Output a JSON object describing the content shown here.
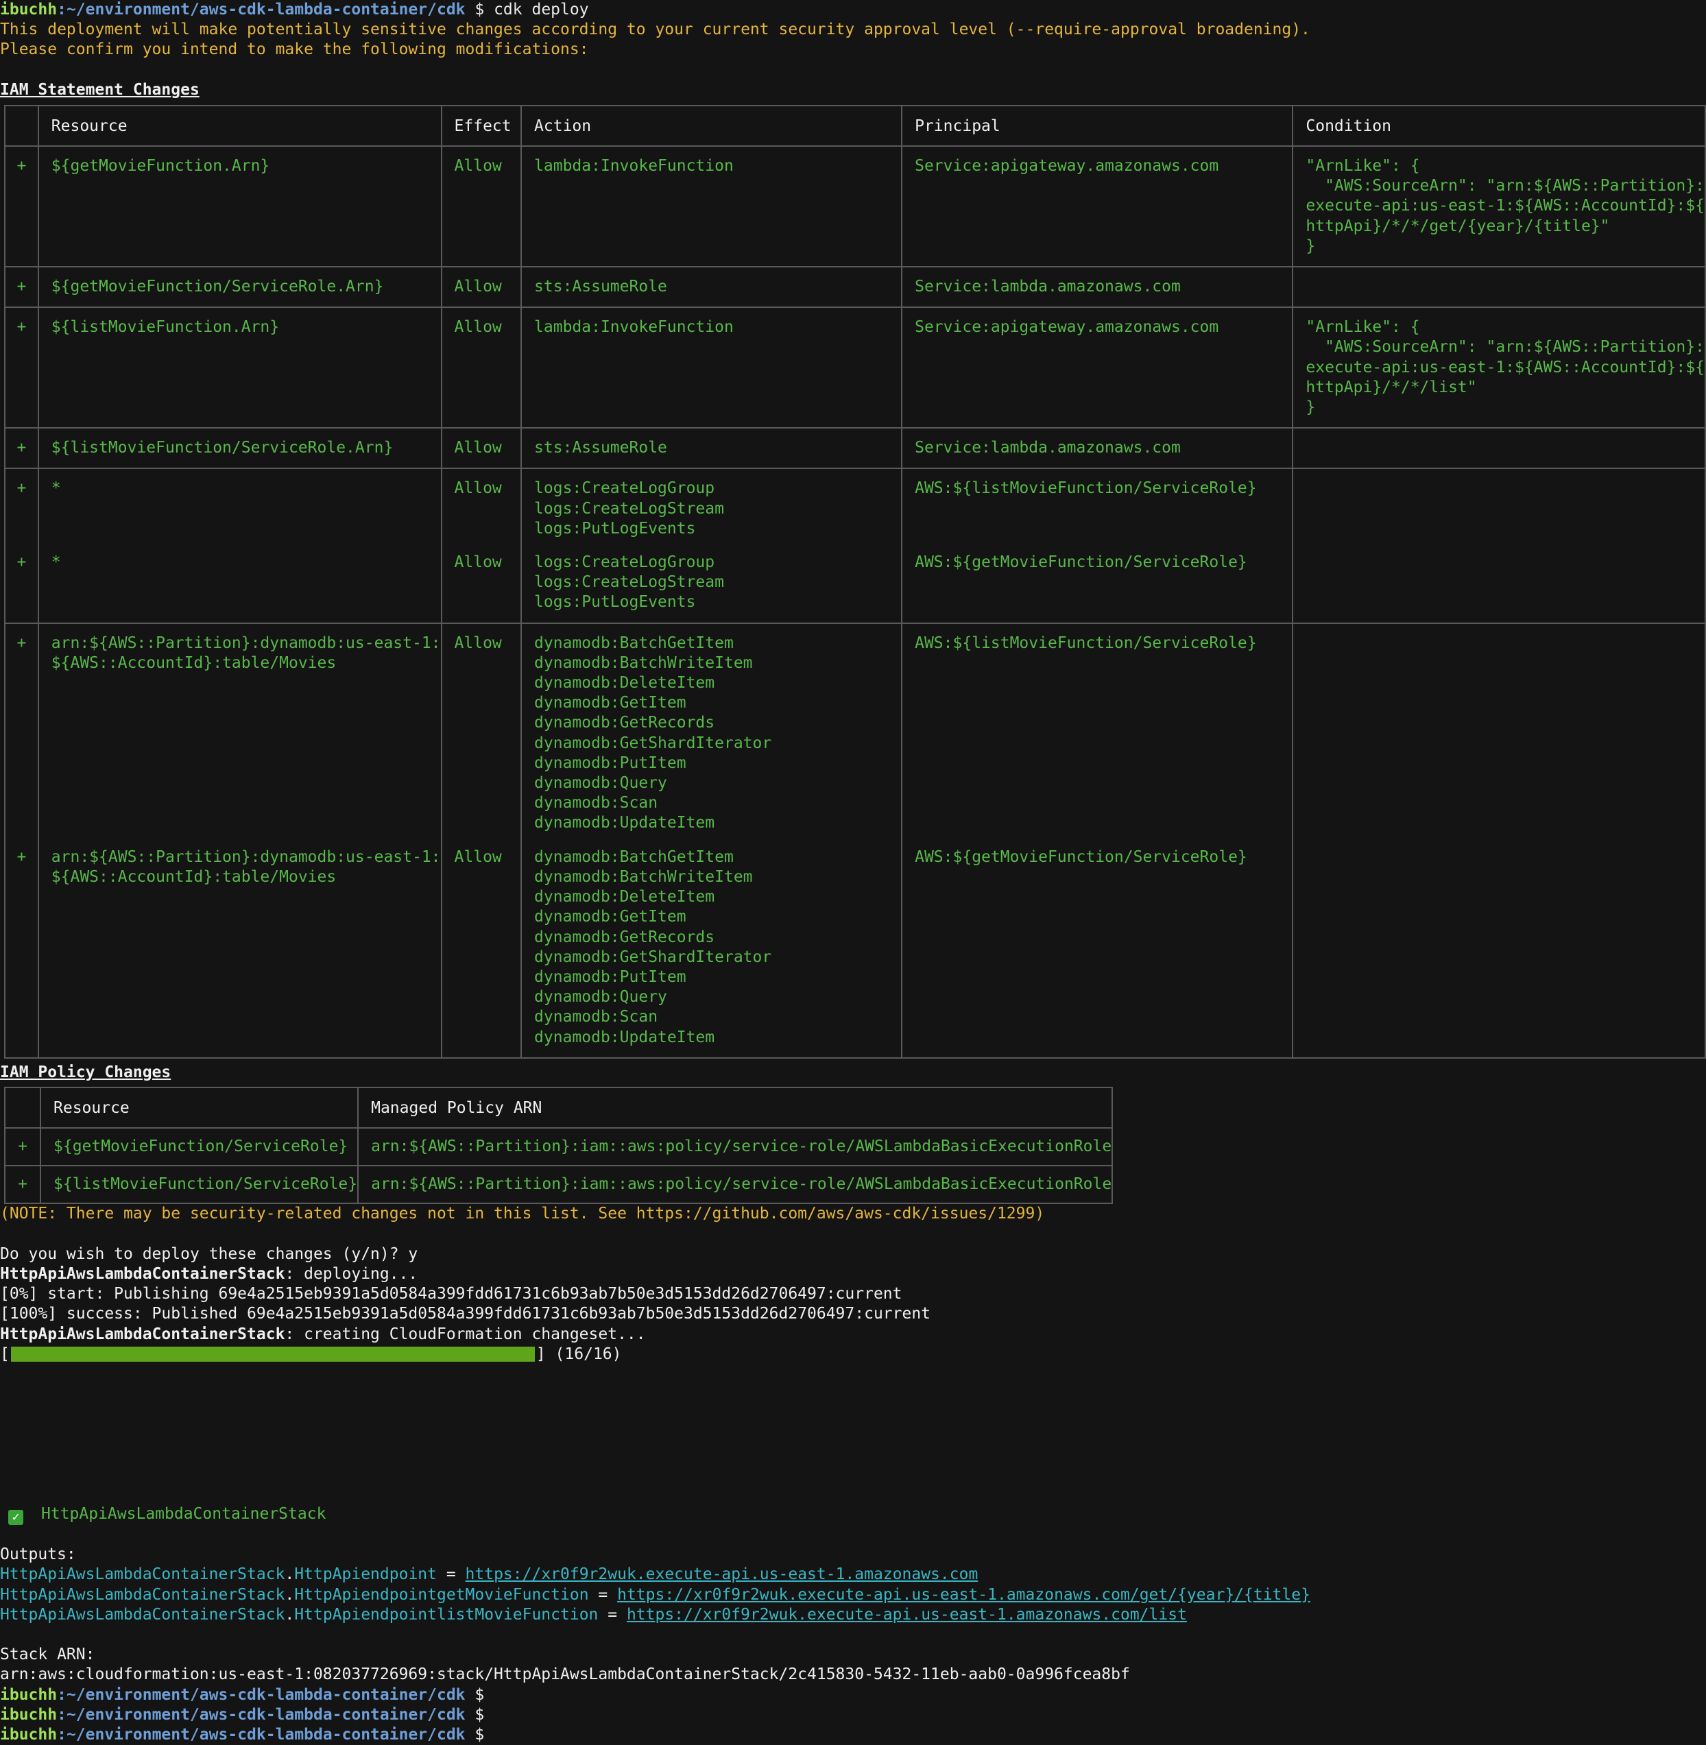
{
  "prompt": {
    "user": "ibuchh",
    "path": ":~/environment/aws-cdk-lambda-container/cdk",
    "symbol": " $ "
  },
  "command": "cdk deploy",
  "warning_lines": [
    "This deployment will make potentially sensitive changes according to your current security approval level (--require-approval broadening).",
    "Please confirm you intend to make the following modifications:"
  ],
  "iam_statement": {
    "title": "IAM Statement Changes",
    "headers": [
      "",
      "Resource",
      "Effect",
      "Action",
      "Principal",
      "Condition"
    ],
    "rows": [
      {
        "sign": "+",
        "resource": [
          "${getMovieFunction.Arn}"
        ],
        "effect": "Allow",
        "action": [
          "lambda:InvokeFunction"
        ],
        "principal": [
          "Service:apigateway.amazonaws.com"
        ],
        "condition": [
          "\"ArnLike\": {",
          "  \"AWS:SourceArn\": \"arn:${AWS::Partition}:",
          "execute-api:us-east-1:${AWS::AccountId}:${",
          "httpApi}/*/*/get/{year}/{title}\"",
          "}"
        ]
      },
      {
        "sign": "+",
        "resource": [
          "${getMovieFunction/ServiceRole.Arn}"
        ],
        "effect": "Allow",
        "action": [
          "sts:AssumeRole"
        ],
        "principal": [
          "Service:lambda.amazonaws.com"
        ],
        "condition": []
      },
      {
        "sign": "+",
        "resource": [
          "${listMovieFunction.Arn}"
        ],
        "effect": "Allow",
        "action": [
          "lambda:InvokeFunction"
        ],
        "principal": [
          "Service:apigateway.amazonaws.com"
        ],
        "condition": [
          "\"ArnLike\": {",
          "  \"AWS:SourceArn\": \"arn:${AWS::Partition}:",
          "execute-api:us-east-1:${AWS::AccountId}:${",
          "httpApi}/*/*/list\"",
          "}"
        ]
      },
      {
        "sign": "+",
        "resource": [
          "${listMovieFunction/ServiceRole.Arn}"
        ],
        "effect": "Allow",
        "action": [
          "sts:AssumeRole"
        ],
        "principal": [
          "Service:lambda.amazonaws.com"
        ],
        "condition": []
      },
      {
        "sign": "+",
        "resource": [
          "*"
        ],
        "effect": "Allow",
        "action": [
          "logs:CreateLogGroup",
          "logs:CreateLogStream",
          "logs:PutLogEvents"
        ],
        "principal": [
          "AWS:${listMovieFunction/ServiceRole}"
        ],
        "condition": []
      },
      {
        "sign": "+",
        "resource": [
          "*"
        ],
        "effect": "Allow",
        "action": [
          "logs:CreateLogGroup",
          "logs:CreateLogStream",
          "logs:PutLogEvents"
        ],
        "principal": [
          "AWS:${getMovieFunction/ServiceRole}"
        ],
        "condition": []
      },
      {
        "sign": "+",
        "resource": [
          "arn:${AWS::Partition}:dynamodb:us-east-1:",
          "${AWS::AccountId}:table/Movies"
        ],
        "effect": "Allow",
        "action": [
          "dynamodb:BatchGetItem",
          "dynamodb:BatchWriteItem",
          "dynamodb:DeleteItem",
          "dynamodb:GetItem",
          "dynamodb:GetRecords",
          "dynamodb:GetShardIterator",
          "dynamodb:PutItem",
          "dynamodb:Query",
          "dynamodb:Scan",
          "dynamodb:UpdateItem"
        ],
        "principal": [
          "AWS:${listMovieFunction/ServiceRole}"
        ],
        "condition": []
      },
      {
        "sign": "+",
        "resource": [
          "arn:${AWS::Partition}:dynamodb:us-east-1:",
          "${AWS::AccountId}:table/Movies"
        ],
        "effect": "Allow",
        "action": [
          "dynamodb:BatchGetItem",
          "dynamodb:BatchWriteItem",
          "dynamodb:DeleteItem",
          "dynamodb:GetItem",
          "dynamodb:GetRecords",
          "dynamodb:GetShardIterator",
          "dynamodb:PutItem",
          "dynamodb:Query",
          "dynamodb:Scan",
          "dynamodb:UpdateItem"
        ],
        "principal": [
          "AWS:${getMovieFunction/ServiceRole}"
        ],
        "condition": []
      }
    ]
  },
  "iam_policy": {
    "title": "IAM Policy Changes",
    "headers": [
      "",
      "Resource",
      "Managed Policy ARN"
    ],
    "rows": [
      {
        "sign": "+",
        "resource": "${getMovieFunction/ServiceRole}",
        "arn": "arn:${AWS::Partition}:iam::aws:policy/service-role/AWSLambdaBasicExecutionRole"
      },
      {
        "sign": "+",
        "resource": "${listMovieFunction/ServiceRole}",
        "arn": "arn:${AWS::Partition}:iam::aws:policy/service-role/AWSLambdaBasicExecutionRole"
      }
    ]
  },
  "note": "(NOTE: There may be security-related changes not in this list. See https://github.com/aws/aws-cdk/issues/1299)",
  "confirm_prompt": "Do you wish to deploy these changes (y/n)? y",
  "stack_name": "HttpApiAwsLambdaContainerStack",
  "deploy_status": ": deploying...",
  "publish_start": "[0%] start: Publishing 69e4a2515eb9391a5d0584a399fdd61731c6b93ab7b50e3d5153dd26d2706497:current",
  "publish_success": "[100%] success: Published 69e4a2515eb9391a5d0584a399fdd61731c6b93ab7b50e3d5153dd26d2706497:current",
  "changeset_status": ": creating CloudFormation changeset...",
  "progress": {
    "left": "[",
    "right": "] (16/16)",
    "fraction": 1.0
  },
  "success_stack": "HttpApiAwsLambdaContainerStack",
  "outputs_label": "Outputs:",
  "outputs": [
    {
      "stack": "HttpApiAwsLambdaContainerStack",
      "key": "HttpApiendpoint",
      "eq": " = ",
      "url": "https://xr0f9r2wuk.execute-api.us-east-1.amazonaws.com"
    },
    {
      "stack": "HttpApiAwsLambdaContainerStack",
      "key": "HttpApiendpointgetMovieFunction",
      "eq": " = ",
      "url": "https://xr0f9r2wuk.execute-api.us-east-1.amazonaws.com/get/{year}/{title}"
    },
    {
      "stack": "HttpApiAwsLambdaContainerStack",
      "key": "HttpApiendpointlistMovieFunction",
      "eq": " = ",
      "url": "https://xr0f9r2wuk.execute-api.us-east-1.amazonaws.com/list"
    }
  ],
  "stack_arn_label": "Stack ARN:",
  "stack_arn": "arn:aws:cloudformation:us-east-1:082037726969:stack/HttpApiAwsLambdaContainerStack/2c415830-5432-11eb-aab0-0a996fcea8bf",
  "trailing_prompts": 3,
  "colors": {
    "background": "#141414",
    "green": "#58b84a",
    "yellow": "#e5b53b",
    "cyan": "#3ab6c4",
    "user": "#9fe25a",
    "path": "#6f9fd8",
    "progress": "#5ea51c"
  },
  "icons": {
    "success": "check-box-icon"
  }
}
